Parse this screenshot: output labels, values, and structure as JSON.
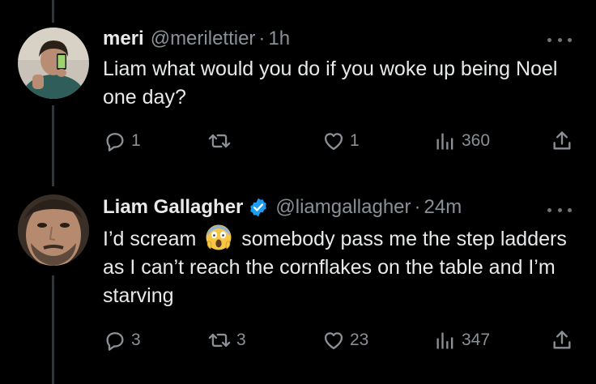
{
  "tweets": [
    {
      "name": "meri",
      "handle": "@merilettier",
      "separator": "·",
      "time": "1h",
      "text": "Liam what would you do if you woke up being Noel one day?",
      "reply_count": "1",
      "retweet_count": "",
      "like_count": "1",
      "view_count": "360"
    },
    {
      "name": "Liam Gallagher",
      "verified": true,
      "handle": "@liamgallagher",
      "separator": "·",
      "time": "24m",
      "text_before_emoji": "I’d scream",
      "emoji": "face-screaming-in-fear-emoji",
      "text_after_emoji": "somebody pass me the step ladders as I can’t reach the cornflakes on the table and I’m starving",
      "reply_count": "3",
      "retweet_count": "3",
      "like_count": "23",
      "view_count": "347"
    }
  ],
  "icons": {
    "reply": "reply-icon",
    "retweet": "retweet-icon",
    "like": "heart-icon",
    "views": "analytics-icon",
    "share": "share-icon",
    "more": "more-icon",
    "verified": "verified-badge-icon"
  },
  "colors": {
    "background": "#000000",
    "text": "#e7e9ea",
    "secondary": "#8b9096",
    "verified": "#1d9bf0",
    "thread_line": "#333639"
  }
}
